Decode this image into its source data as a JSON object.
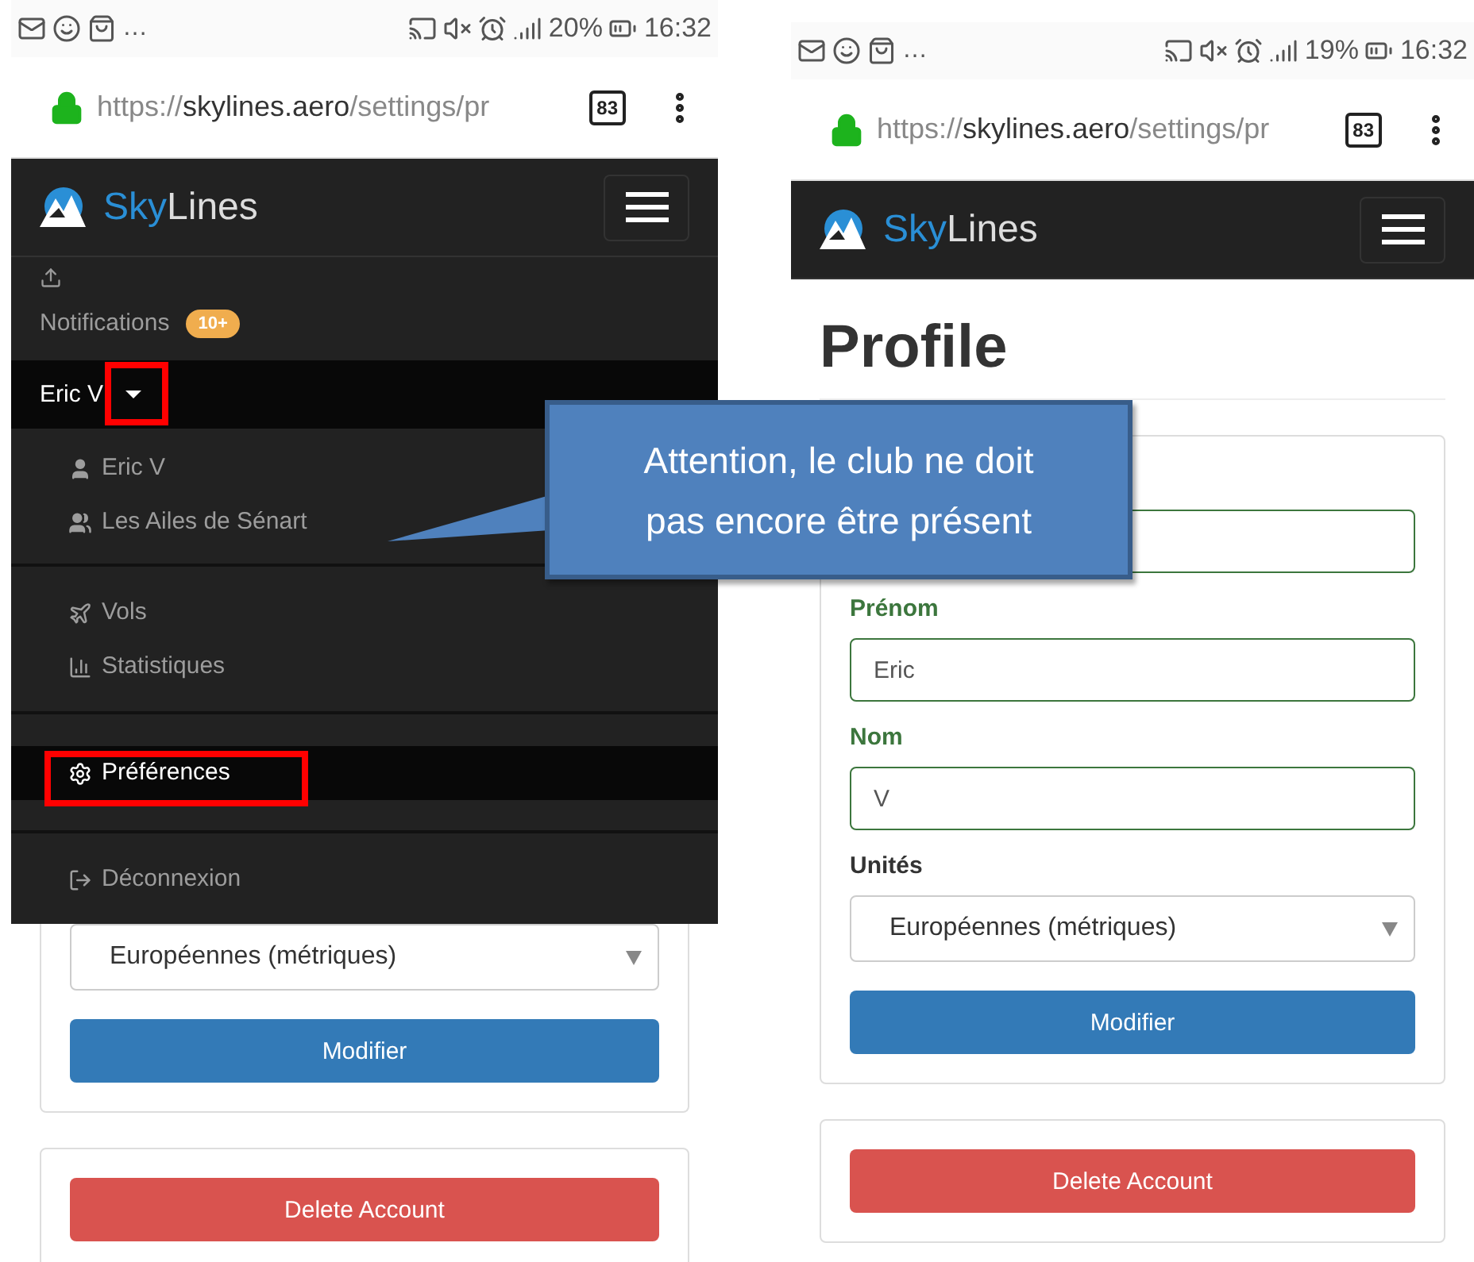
{
  "left_phone": {
    "status_bar": {
      "more": "…",
      "battery": "20%",
      "time": "16:32"
    },
    "address_bar": {
      "scheme": "https://",
      "host": "skylines.aero",
      "path": "/settings/pr",
      "tab_count": "83"
    },
    "navbar": {
      "brand_first": "Sky",
      "brand_rest": "Lines"
    },
    "menu": {
      "notifications": {
        "label": "Notifications",
        "badge": "10+"
      },
      "user_dropdown": {
        "label": "Eric V",
        "expanded": true,
        "children": [
          {
            "label": "Eric V"
          },
          {
            "label": "Les Ailes de Sénart"
          }
        ]
      },
      "sections": [
        [
          {
            "label": "Vols",
            "selected": false
          },
          {
            "label": "Statistiques",
            "selected": false
          }
        ],
        [
          {
            "label": "Préférences",
            "selected": true
          }
        ],
        [
          {
            "label": "Déconnexion",
            "selected": false
          }
        ]
      ]
    },
    "form": {
      "units_value": "Européennes (métriques)",
      "submit": "Modifier",
      "delete": "Delete Account"
    }
  },
  "right_phone": {
    "status_bar": {
      "more": "…",
      "battery": "19%",
      "time": "16:32"
    },
    "address_bar": {
      "scheme": "https://",
      "host": "skylines.aero",
      "path": "/settings/pr",
      "tab_count": "83"
    },
    "navbar": {
      "brand_first": "Sky",
      "brand_rest": "Lines"
    },
    "heading": "Profile",
    "form": {
      "fields": [
        {
          "valid": true
        },
        {
          "label": "Prénom",
          "value": "Eric",
          "valid": true
        },
        {
          "label": "Nom",
          "value": "V",
          "valid": true
        }
      ],
      "units_label": "Unités",
      "units_value": "Européennes (métriques)",
      "submit": "Modifier",
      "delete": "Delete Account"
    }
  },
  "callout": {
    "text": "Attention, le club ne doit pas encore être présent"
  }
}
